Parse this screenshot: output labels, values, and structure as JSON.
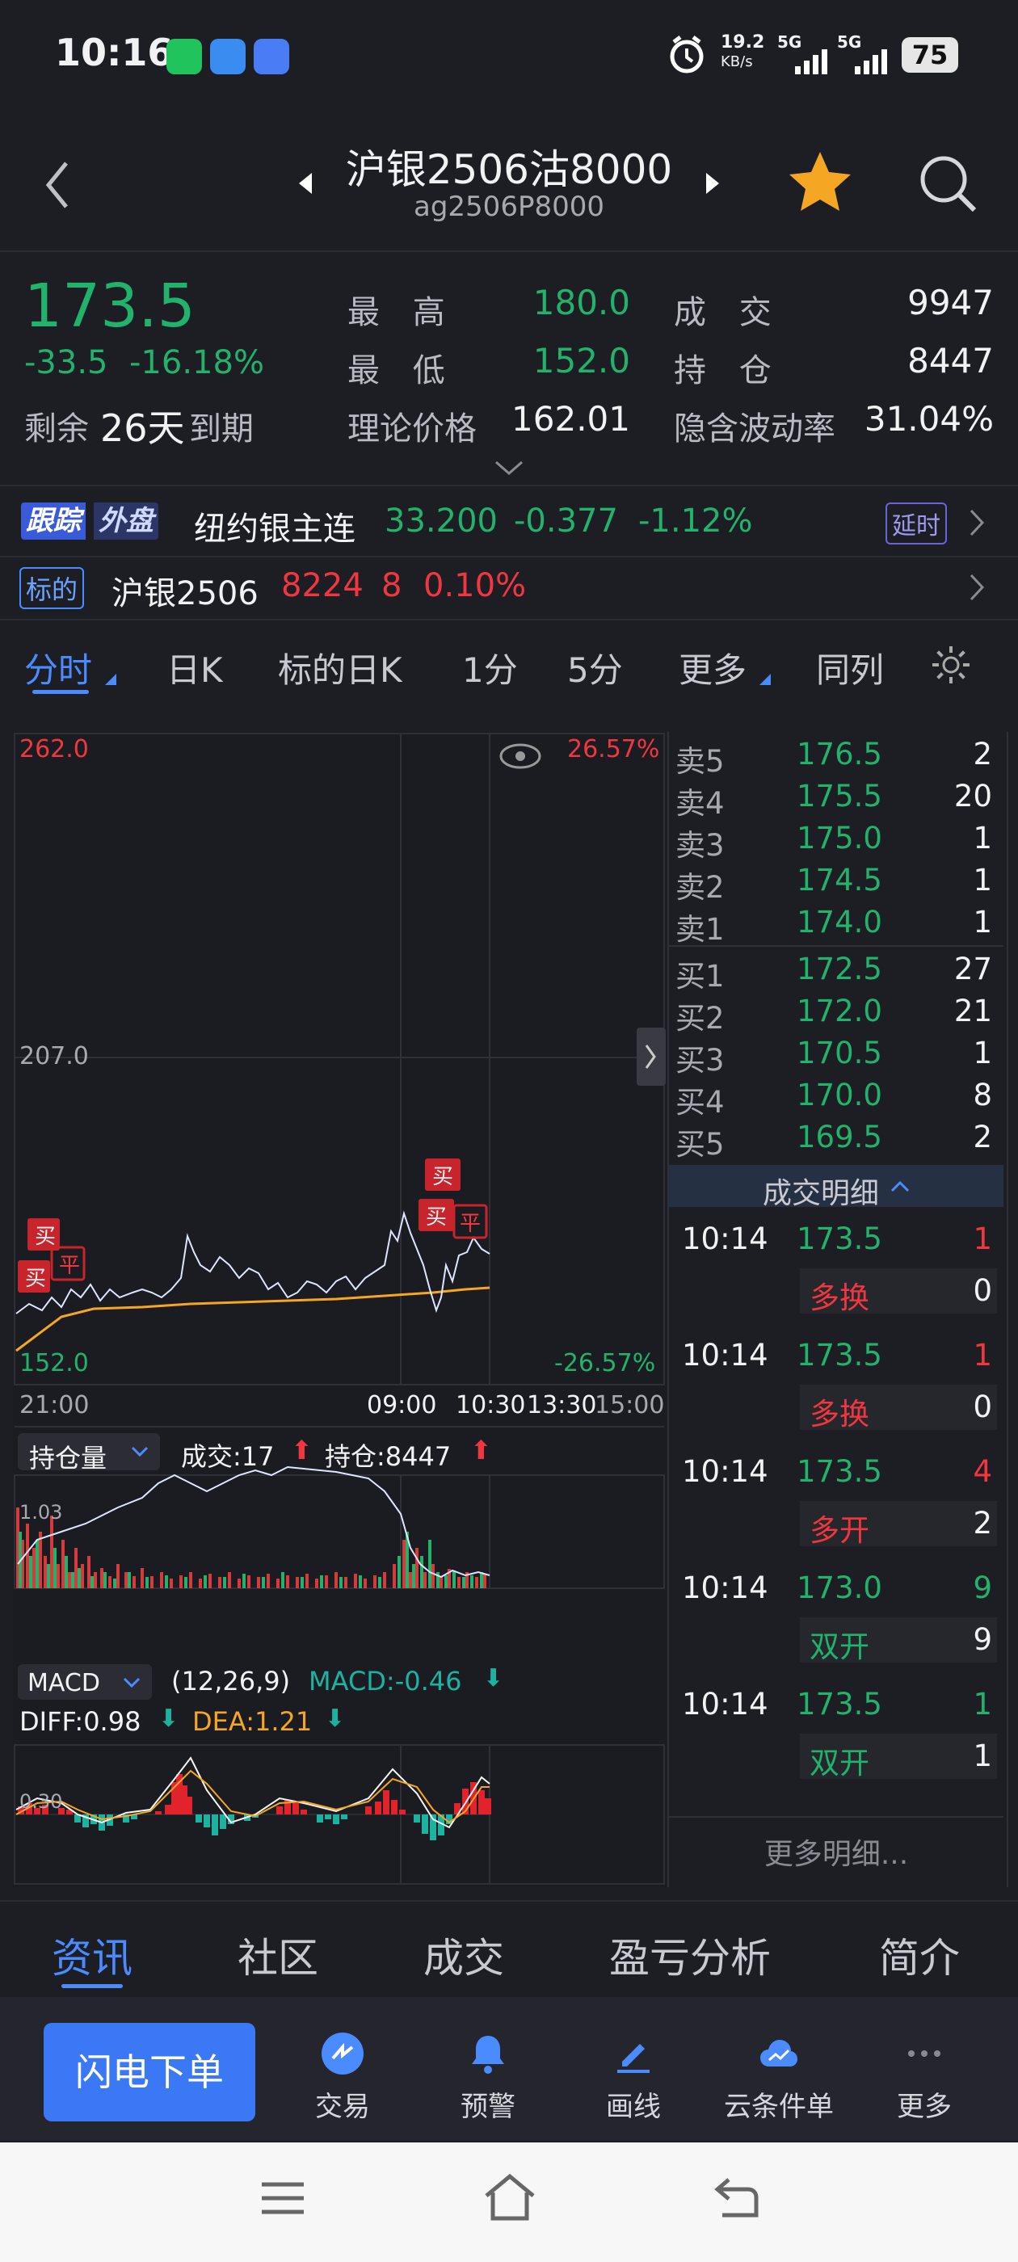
{
  "status_bar": {
    "time": "10:16",
    "net_speed": "19.2",
    "net_unit": "KB/s",
    "signal1": "5G",
    "signal2": "5G",
    "battery": "75"
  },
  "header": {
    "title": "沪银2506沽8000",
    "subtitle": "ag2506P8000"
  },
  "quote": {
    "price": "173.5",
    "change": "-33.5",
    "change_pct": "-16.18%",
    "remaining_label": "剩余",
    "remaining_value": "26天",
    "expiry_label": "到期",
    "high_label": "最 高",
    "high": "180.0",
    "low_label": "最 低",
    "low": "152.0",
    "theory_label": "理论价格",
    "theory": "162.01",
    "volume_label": "成 交",
    "volume": "9947",
    "oi_label": "持 仓",
    "oi": "8447",
    "iv_label": "隐含波动率",
    "iv": "31.04%"
  },
  "tracking": {
    "badge1": "跟踪",
    "badge2": "外盘",
    "name": "纽约银主连",
    "price": "33.200",
    "change": "-0.377",
    "pct": "-1.12%",
    "delay": "延时"
  },
  "underlying": {
    "badge": "标的",
    "name": "沪银2506",
    "price": "8224",
    "change": "8",
    "pct": "0.10%"
  },
  "tabs": [
    "分时",
    "日K",
    "标的日K",
    "1分",
    "5分",
    "更多",
    "同列"
  ],
  "chart": {
    "y_top": "262.0",
    "y_mid": "207.0",
    "y_bottom": "152.0",
    "pct_top": "26.57%",
    "pct_bottom": "-26.57%",
    "t1": "21:00",
    "t2": "09:00",
    "t3": "10:30",
    "t4": "13:30",
    "t5": "15:00",
    "markers": [
      "买",
      "平",
      "买",
      "买",
      "买",
      "平"
    ],
    "sub_selector": "持仓量",
    "sub_vol": "成交:17",
    "sub_oi": "持仓:8447",
    "sub_axis": "1.03",
    "macd_selector": "MACD",
    "macd_params": "(12,26,9)",
    "macd_val": "MACD:-0.46",
    "diff": "DIFF:0.98",
    "dea": "DEA:1.21",
    "macd_axis": "0.30"
  },
  "order_book": {
    "asks": [
      {
        "l": "卖5",
        "p": "176.5",
        "v": "2"
      },
      {
        "l": "卖4",
        "p": "175.5",
        "v": "20"
      },
      {
        "l": "卖3",
        "p": "175.0",
        "v": "1"
      },
      {
        "l": "卖2",
        "p": "174.5",
        "v": "1"
      },
      {
        "l": "卖1",
        "p": "174.0",
        "v": "1"
      }
    ],
    "bids": [
      {
        "l": "买1",
        "p": "172.5",
        "v": "27"
      },
      {
        "l": "买2",
        "p": "172.0",
        "v": "21"
      },
      {
        "l": "买3",
        "p": "170.5",
        "v": "1"
      },
      {
        "l": "买4",
        "p": "170.0",
        "v": "8"
      },
      {
        "l": "买5",
        "p": "169.5",
        "v": "2"
      }
    ],
    "detail_title": "成交明细",
    "trades": [
      {
        "t": "10:14",
        "p": "173.5",
        "v": "1",
        "type": "多换",
        "oi": "0"
      },
      {
        "t": "10:14",
        "p": "173.5",
        "v": "1",
        "type": "多换",
        "oi": "0"
      },
      {
        "t": "10:14",
        "p": "173.5",
        "v": "4",
        "type": "多开",
        "oi": "2"
      },
      {
        "t": "10:14",
        "p": "173.0",
        "v": "9",
        "type": "双开",
        "oi": "9"
      },
      {
        "t": "10:14",
        "p": "173.5",
        "v": "1",
        "type": "双开",
        "oi": "1"
      }
    ],
    "more": "更多明细..."
  },
  "bottom_tabs": [
    "资讯",
    "社区",
    "成交",
    "盈亏分析",
    "简介"
  ],
  "actions": {
    "flash": "闪电下单",
    "a1": "交易",
    "a2": "预警",
    "a3": "画线",
    "a4": "云条件单",
    "a5": "更多"
  },
  "colors": {
    "green": "#21b36b",
    "red": "#f0373f",
    "orange": "#f5a623",
    "accent": "#4a8cff",
    "bg": "#1d1e24"
  }
}
